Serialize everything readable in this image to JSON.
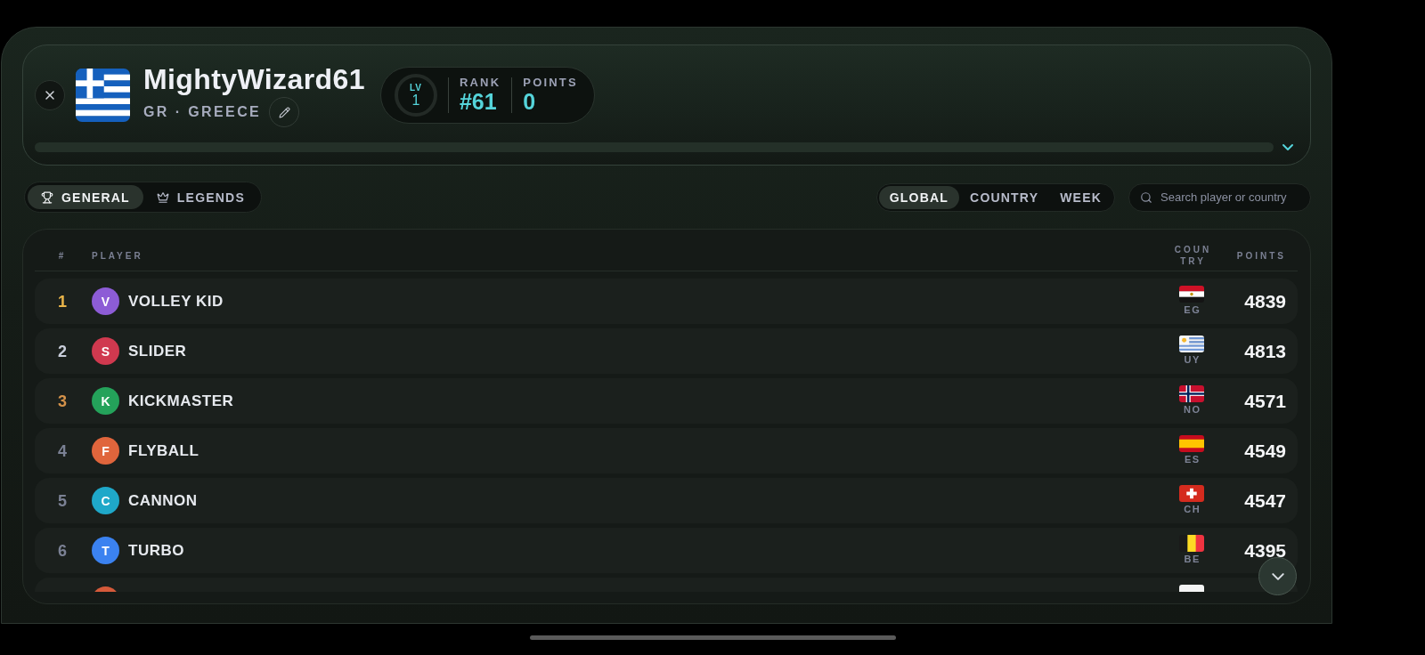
{
  "profile": {
    "flag": {
      "kind": "greece"
    },
    "name": "MightyWizard61",
    "country": "GR · GREECE",
    "badge": {
      "label": "LV",
      "value": "1"
    },
    "stats": [
      {
        "label": "RANK",
        "value": "#61"
      },
      {
        "label": "POINTS",
        "value": "0"
      }
    ]
  },
  "mode_tabs": [
    {
      "label": "GENERAL",
      "kind": "trophy",
      "selected": true
    },
    {
      "label": "LEGENDS",
      "kind": "crown",
      "selected": false
    }
  ],
  "scope_tabs": [
    {
      "label": "GLOBAL",
      "selected": true
    },
    {
      "label": "COUNTRY",
      "selected": false
    },
    {
      "label": "WEEK",
      "selected": false
    }
  ],
  "search": {
    "placeholder": "Search player or country"
  },
  "table": {
    "columns": [
      "#",
      "PLAYER",
      "COUNTRY",
      "POINTS"
    ],
    "rows": [
      {
        "rank": {
          "label": "1",
          "color": "#eab54a"
        },
        "avatar": {
          "initial": "V",
          "color": "#8d5cd6"
        },
        "name": "VOLLEY KID",
        "country": {
          "kind": "egypt",
          "code": "EG"
        },
        "points": "4839"
      },
      {
        "rank": {
          "label": "2",
          "color": "#c9cedb"
        },
        "avatar": {
          "initial": "S",
          "color": "#d0394f"
        },
        "name": "SLIDER",
        "country": {
          "kind": "uruguay",
          "code": "UY"
        },
        "points": "4813"
      },
      {
        "rank": {
          "label": "3",
          "color": "#d4924a"
        },
        "avatar": {
          "initial": "K",
          "color": "#24a25a"
        },
        "name": "KICKMASTER",
        "country": {
          "kind": "norway",
          "code": "NO"
        },
        "points": "4571"
      },
      {
        "rank": {
          "label": "4",
          "color": "#7b8194"
        },
        "avatar": {
          "initial": "F",
          "color": "#e0653c"
        },
        "name": "FLYBALL",
        "country": {
          "kind": "spain",
          "code": "ES"
        },
        "points": "4549"
      },
      {
        "rank": {
          "label": "5",
          "color": "#7b8194"
        },
        "avatar": {
          "initial": "C",
          "color": "#1fa8c9"
        },
        "name": "CANNON",
        "country": {
          "kind": "switzerland",
          "code": "CH"
        },
        "points": "4547"
      },
      {
        "rank": {
          "label": "6",
          "color": "#7b8194"
        },
        "avatar": {
          "initial": "T",
          "color": "#3b82f0"
        },
        "name": "TURBO",
        "country": {
          "kind": "belgium",
          "code": "BE"
        },
        "points": "4395"
      },
      {
        "avatar": {
          "color": "#d55a3a"
        },
        "country": {
          "kind": "poland"
        }
      }
    ]
  }
}
